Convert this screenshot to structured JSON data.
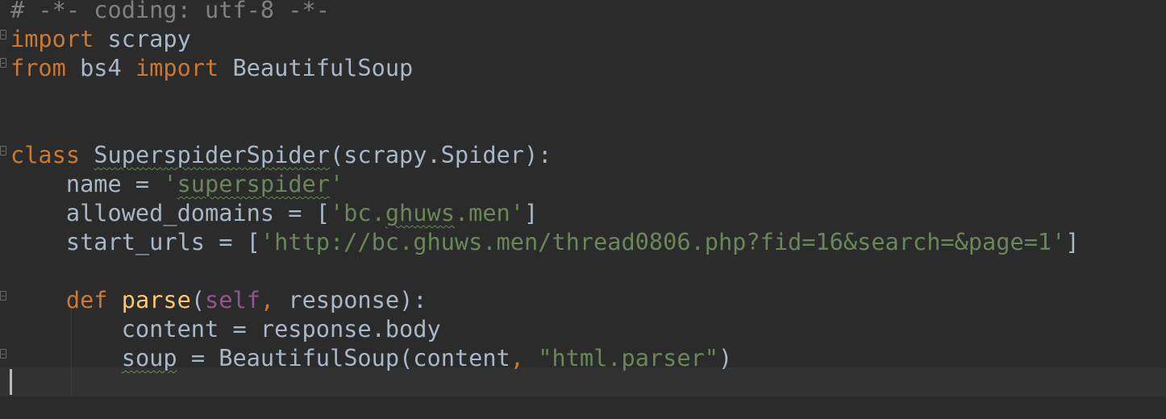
{
  "editor": {
    "lines": [
      [
        {
          "t": "# -*- coding: utf-8 -*-",
          "c": "comment"
        }
      ],
      [
        {
          "t": "import",
          "c": "kw"
        },
        {
          "t": " scrapy",
          "c": "plain"
        }
      ],
      [
        {
          "t": "from",
          "c": "kw"
        },
        {
          "t": " bs4 ",
          "c": "plain"
        },
        {
          "t": "import",
          "c": "kw"
        },
        {
          "t": " BeautifulSoup",
          "c": "plain"
        }
      ],
      [],
      [],
      [
        {
          "t": "class",
          "c": "kw"
        },
        {
          "t": " ",
          "c": "plain"
        },
        {
          "t": "SuperspiderSpider",
          "c": "plain",
          "typo": true
        },
        {
          "t": "(scrapy.Spider):",
          "c": "plain"
        }
      ],
      [
        {
          "t": "    name = ",
          "c": "plain"
        },
        {
          "t": "'",
          "c": "str"
        },
        {
          "t": "superspider",
          "c": "str",
          "typo": true
        },
        {
          "t": "'",
          "c": "str"
        }
      ],
      [
        {
          "t": "    allowed_domains = [",
          "c": "plain"
        },
        {
          "t": "'bc.",
          "c": "str"
        },
        {
          "t": "ghuws",
          "c": "str",
          "typo": true
        },
        {
          "t": ".men'",
          "c": "str"
        },
        {
          "t": "]",
          "c": "plain"
        }
      ],
      [
        {
          "t": "    start_urls = [",
          "c": "plain"
        },
        {
          "t": "'http://bc.ghuws.men/thread0806.php?fid=16&search=&page=1'",
          "c": "str"
        },
        {
          "t": "]",
          "c": "plain"
        }
      ],
      [],
      [
        {
          "t": "    ",
          "c": "plain"
        },
        {
          "t": "def",
          "c": "kw"
        },
        {
          "t": " ",
          "c": "plain"
        },
        {
          "t": "parse",
          "c": "fn"
        },
        {
          "t": "(",
          "c": "plain"
        },
        {
          "t": "self",
          "c": "self"
        },
        {
          "t": ",",
          "c": "kw"
        },
        {
          "t": " response):",
          "c": "plain"
        }
      ],
      [
        {
          "t": "        content = response.body",
          "c": "plain"
        }
      ],
      [
        {
          "t": "        ",
          "c": "plain"
        },
        {
          "t": "soup",
          "c": "plain",
          "typo": true
        },
        {
          "t": " = BeautifulSoup(content",
          "c": "plain"
        },
        {
          "t": ",",
          "c": "kw"
        },
        {
          "t": " ",
          "c": "plain"
        },
        {
          "t": "\"html.parser\"",
          "c": "str"
        },
        {
          "t": ")",
          "c": "plain"
        }
      ],
      []
    ]
  }
}
